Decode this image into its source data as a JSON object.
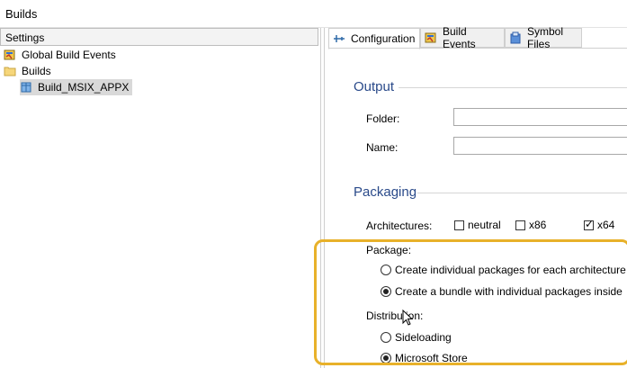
{
  "window": {
    "title": "Builds"
  },
  "left": {
    "header": "Settings",
    "tree": [
      {
        "label": "Global Build Events",
        "icon": "build-events-icon"
      },
      {
        "label": "Builds",
        "icon": "folder-icon"
      },
      {
        "label": "Build_MSIX_APPX",
        "icon": "package-icon",
        "selected": true
      }
    ]
  },
  "tabs": [
    {
      "label": "Configuration",
      "icon": "configuration-icon",
      "active": true
    },
    {
      "label": "Build Events",
      "icon": "build-events-icon",
      "active": false
    },
    {
      "label": "Symbol Files",
      "icon": "symbol-files-icon",
      "active": false
    }
  ],
  "output": {
    "title": "Output",
    "folder_label": "Folder:",
    "folder_value": "",
    "name_label": "Name:",
    "name_value": ""
  },
  "packaging": {
    "title": "Packaging",
    "architectures_label": "Architectures:",
    "architectures": [
      {
        "label": "neutral",
        "checked": false
      },
      {
        "label": "x86",
        "checked": false
      },
      {
        "label": "x64",
        "checked": true
      }
    ],
    "package_label": "Package:",
    "package_options": [
      {
        "label": "Create individual packages for each architecture",
        "selected": false
      },
      {
        "label": "Create a bundle with individual packages inside",
        "selected": true
      }
    ],
    "distribution_label": "Distribution:",
    "distribution_options": [
      {
        "label": "Sideloading",
        "selected": false
      },
      {
        "label": "Microsoft Store",
        "selected": true
      }
    ]
  },
  "colors": {
    "highlight": "#e8b12a",
    "section_title": "#2a4a8a"
  }
}
